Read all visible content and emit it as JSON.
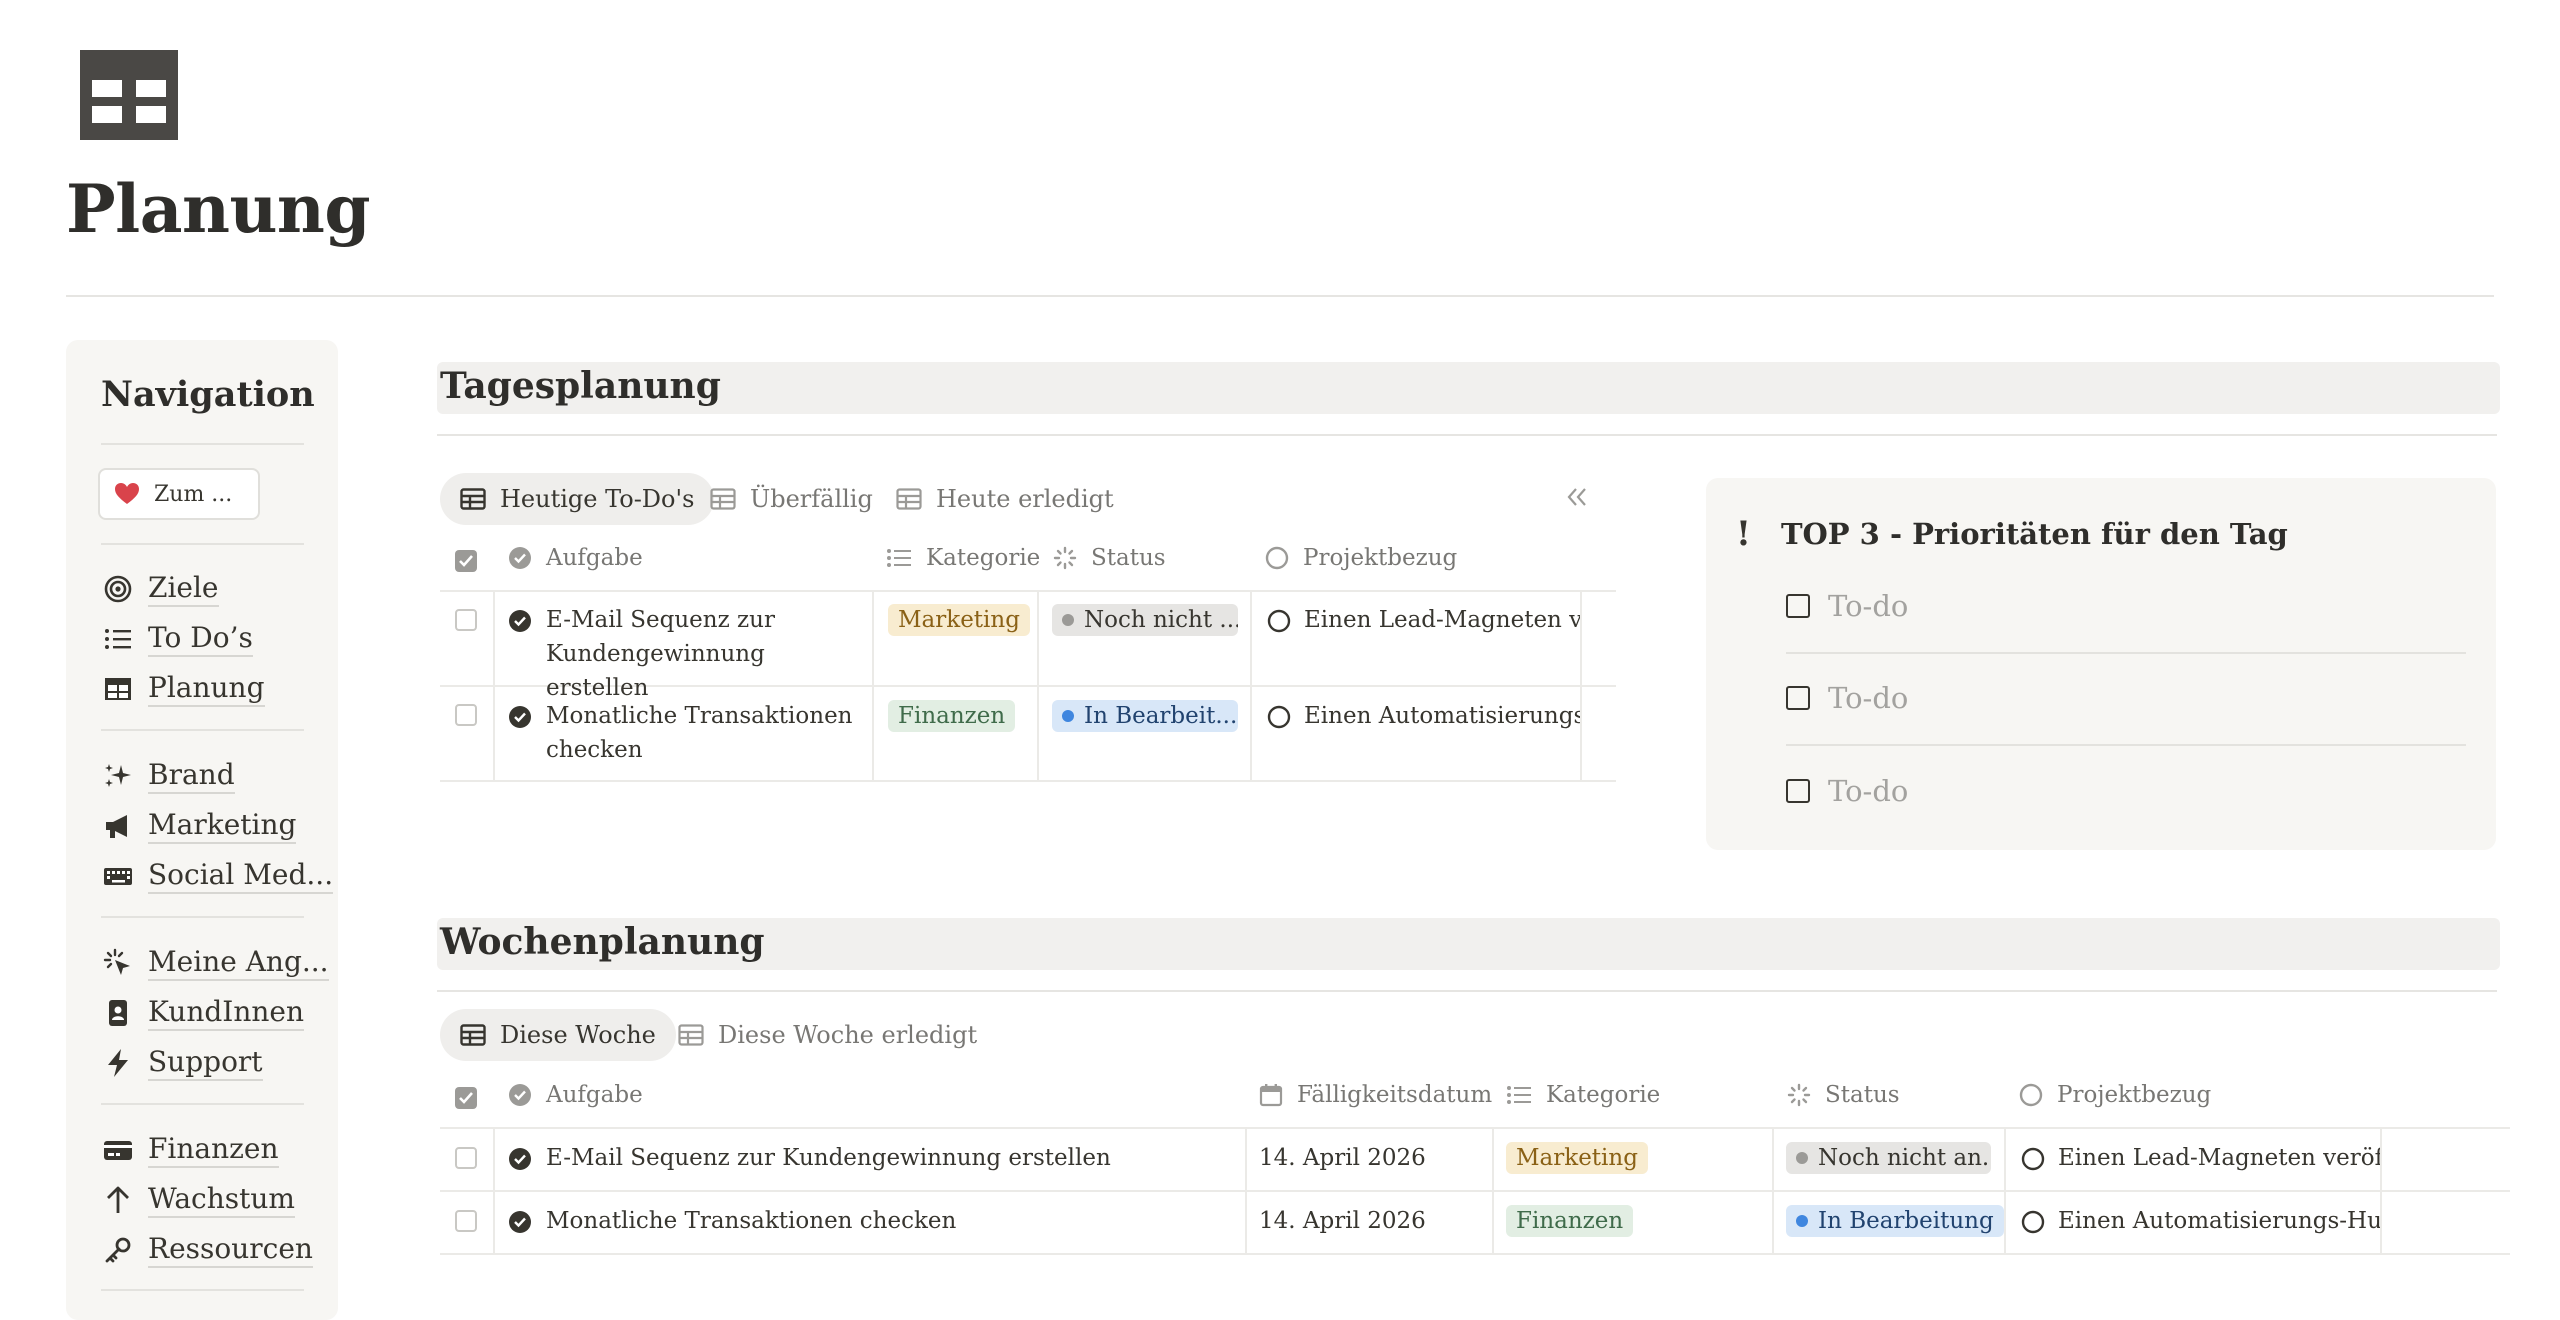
{
  "page": {
    "title": "Planung",
    "icon": "table-icon"
  },
  "navigation": {
    "heading": "Navigation",
    "back_button": {
      "label": "Zum ...",
      "icon": "heart-icon"
    },
    "groups": [
      [
        {
          "label": "Ziele",
          "icon": "target-icon"
        },
        {
          "label": "To Do’s",
          "icon": "list-icon"
        },
        {
          "label": "Planung",
          "icon": "table-icon"
        }
      ],
      [
        {
          "label": "Brand",
          "icon": "sparkles-icon"
        },
        {
          "label": "Marketing",
          "icon": "megaphone-icon"
        },
        {
          "label": "Social Med...",
          "icon": "keyboard-icon"
        }
      ],
      [
        {
          "label": "Meine Ang...",
          "icon": "click-icon"
        },
        {
          "label": "KundInnen",
          "icon": "contact-card-icon"
        },
        {
          "label": "Support",
          "icon": "lightning-icon"
        }
      ],
      [
        {
          "label": "Finanzen",
          "icon": "credit-card-icon"
        },
        {
          "label": "Wachstum",
          "icon": "arrow-up-icon"
        },
        {
          "label": "Ressourcen",
          "icon": "key-icon"
        }
      ]
    ]
  },
  "daily": {
    "heading": "Tagesplanung",
    "tabs": [
      "Heutige To-Do's",
      "Überfällig",
      "Heute erledigt"
    ],
    "columns": {
      "task": "Aufgabe",
      "category": "Kategorie",
      "status": "Status",
      "project": "Projektbezug"
    },
    "rows": [
      {
        "task": "E-Mail Sequenz zur Kundengewinnung erstellen",
        "category": "Marketing",
        "status": "Noch nicht ...",
        "project": "Einen Lead-Magneten veröffentlichen"
      },
      {
        "task": "Monatliche Transaktionen checken",
        "category": "Finanzen",
        "status": "In Bearbeit...",
        "project": "Einen Automatisierungs-Hub einrichten"
      }
    ]
  },
  "priorities": {
    "heading": "TOP 3 - Prioritäten für den Tag",
    "items": [
      "To-do",
      "To-do",
      "To-do"
    ]
  },
  "weekly": {
    "heading": "Wochenplanung",
    "tabs": [
      "Diese Woche",
      "Diese Woche erledigt"
    ],
    "columns": {
      "task": "Aufgabe",
      "due": "Fälligkeitsdatum",
      "category": "Kategorie",
      "status": "Status",
      "project": "Projektbezug"
    },
    "rows": [
      {
        "task": "E-Mail Sequenz zur Kundengewinnung erstellen",
        "due": "14. April 2026",
        "category": "Marketing",
        "status": "Noch nicht an...",
        "project": "Einen Lead-Magneten veröffentlichen"
      },
      {
        "task": "Monatliche Transaktionen checken",
        "due": "14. April 2026",
        "category": "Finanzen",
        "status": "In Bearbeitung",
        "project": "Einen Automatisierungs-Hub einrichten"
      }
    ]
  },
  "colors": {
    "marketing_bg": "#f8ecd0",
    "marketing_fg": "#8a6116",
    "finance_bg": "#e2eee3",
    "finance_fg": "#3f6b4a",
    "status_todo_bg": "#e6e5e3",
    "status_todo_dot": "#9b9a97",
    "status_progress_bg": "#d8e7f8",
    "status_progress_dot": "#3f86df",
    "status_progress_fg": "#21436f"
  }
}
